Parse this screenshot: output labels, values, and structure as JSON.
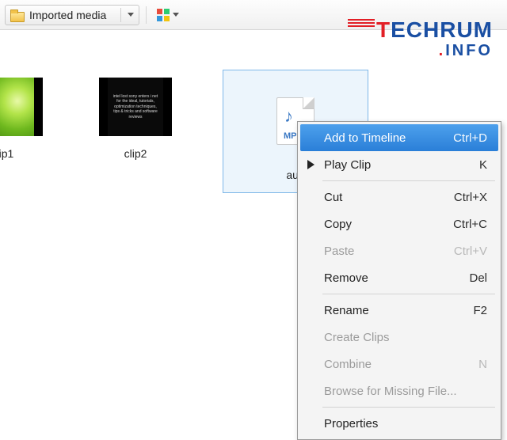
{
  "toolbar": {
    "dropdown_label": "Imported media"
  },
  "thumbs": {
    "clip1_label": "ip1",
    "clip2_label": "clip2",
    "clip2_inner_text": "intel lost sony enters i net for the ideal, tutorials, optimization techniques, tips & tricks and software reviews"
  },
  "selected": {
    "ext": "MP",
    "label": "aud"
  },
  "context_menu": [
    {
      "label": "Add to Timeline",
      "shortcut": "Ctrl+D",
      "highlight": true,
      "enabled": true,
      "icon": ""
    },
    {
      "label": "Play Clip",
      "shortcut": "K",
      "highlight": false,
      "enabled": true,
      "icon": "play"
    },
    {
      "sep": true
    },
    {
      "label": "Cut",
      "shortcut": "Ctrl+X",
      "highlight": false,
      "enabled": true
    },
    {
      "label": "Copy",
      "shortcut": "Ctrl+C",
      "highlight": false,
      "enabled": true
    },
    {
      "label": "Paste",
      "shortcut": "Ctrl+V",
      "highlight": false,
      "enabled": false
    },
    {
      "label": "Remove",
      "shortcut": "Del",
      "highlight": false,
      "enabled": true
    },
    {
      "sep": true
    },
    {
      "label": "Rename",
      "shortcut": "F2",
      "highlight": false,
      "enabled": true
    },
    {
      "label": "Create Clips",
      "shortcut": "",
      "highlight": false,
      "enabled": false
    },
    {
      "label": "Combine",
      "shortcut": "N",
      "highlight": false,
      "enabled": false
    },
    {
      "label": "Browse for Missing File...",
      "shortcut": "",
      "highlight": false,
      "enabled": false
    },
    {
      "sep": true
    },
    {
      "label": "Properties",
      "shortcut": "",
      "highlight": false,
      "enabled": true
    }
  ],
  "watermark": {
    "t": "T",
    "rest": "ECHRUM",
    "dot": ".",
    "sub": "INFO"
  }
}
